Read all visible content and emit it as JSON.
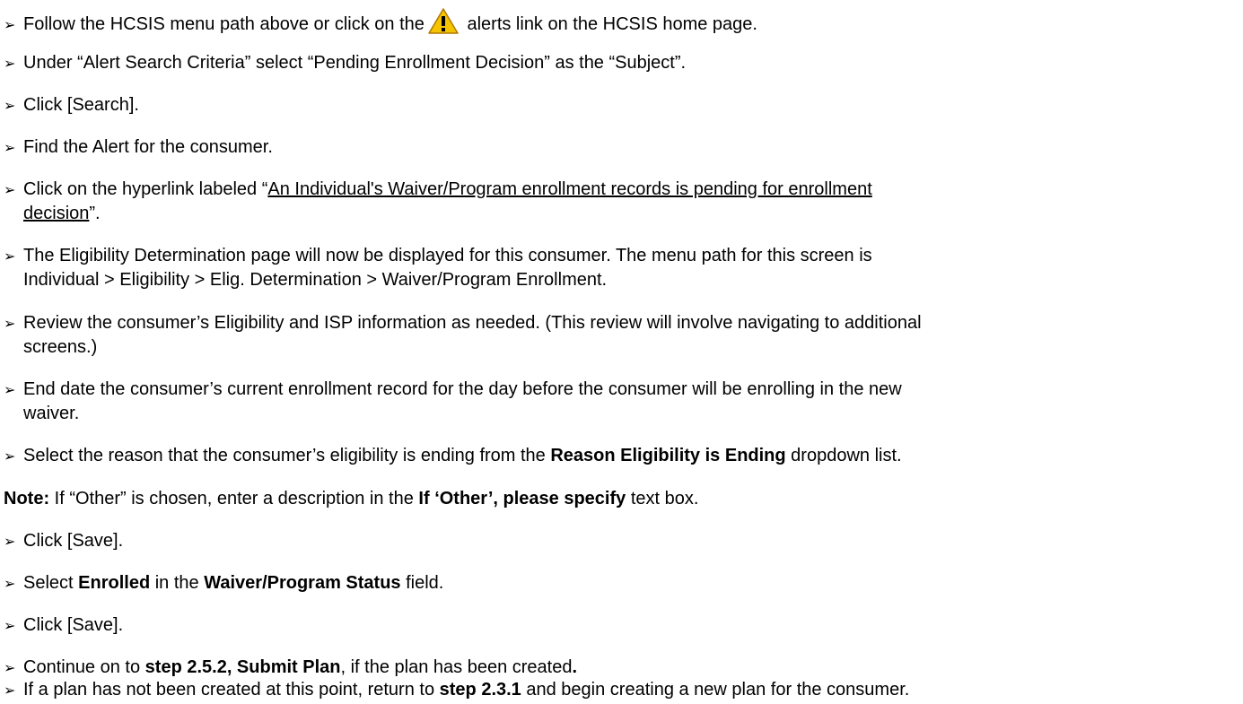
{
  "bullet": "➢",
  "steps": {
    "s1": {
      "before": "Follow the HCSIS menu path above or click on the",
      "after": " alerts link on the HCSIS home page."
    },
    "s2": {
      "text": "Under “Alert Search Criteria” select “Pending Enrollment Decision” as the “Subject”."
    },
    "s3": {
      "text": "Click [Search]."
    },
    "s4": {
      "text": "Find the Alert for the consumer."
    },
    "s5": {
      "before": "Click on the hyperlink labeled “",
      "link1": "An Individual's Waiver/Program enrollment records is pending for enrollment",
      "link2": "decision",
      "after": "”."
    },
    "s6": {
      "line1": "The Eligibility Determination page will now be displayed for this consumer. The menu path for this screen is",
      "line2": "Individual > Eligibility > Elig. Determination > Waiver/Program Enrollment."
    },
    "s7": {
      "line1": "Review the consumer’s Eligibility and ISP information as needed. (This review will involve navigating to additional",
      "line2": "screens.)"
    },
    "s8": {
      "line1": "End date the consumer’s current enrollment record for the day before the consumer will be enrolling in the new",
      "line2": "waiver."
    },
    "s9": {
      "before": "Select the reason that the consumer’s eligibility is ending from the ",
      "bold": "Reason Eligibility is Ending",
      "after": " dropdown list."
    },
    "note": {
      "label": "Note:",
      "before": " If “Other” is chosen, enter a description in the ",
      "bold": "If ‘Other’, please specify",
      "after": " text box."
    },
    "s10": {
      "text": "Click [Save]."
    },
    "s11": {
      "before": "Select ",
      "bold1": "Enrolled",
      "mid": " in the ",
      "bold2": "Waiver/Program Status",
      "after": " field."
    },
    "s12": {
      "text": "Click [Save]."
    },
    "s13": {
      "before": "Continue on to ",
      "bold": "step 2.5.2, Submit Plan",
      "mid": ", if the plan has been created",
      "dot": "."
    },
    "s14": {
      "before": "If a plan has not been created at this point, return to ",
      "bold": "step 2.3.1",
      "after": " and begin creating a new plan for the consumer."
    }
  },
  "icons": {
    "alert": "warning-icon",
    "alert_fill": "#f5c400",
    "alert_stroke": "#b07800"
  }
}
